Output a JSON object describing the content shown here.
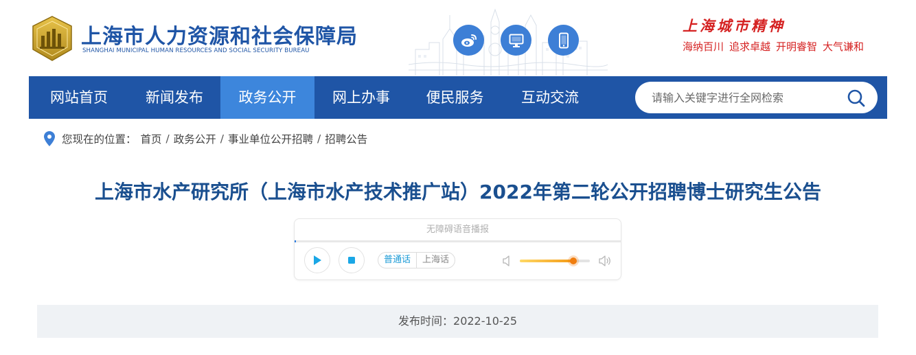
{
  "site": {
    "name_cn": "上海市人力资源和社会保障局",
    "name_en": "SHANGHAI MUNICIPAL HUMAN RESOURCES AND SOCIAL SECURITY BUREAU",
    "logo_icon": "bureau-emblem-icon"
  },
  "header_icons": [
    {
      "name": "weibo-icon"
    },
    {
      "name": "desktop-icon"
    },
    {
      "name": "mobile-icon"
    }
  ],
  "spirit": {
    "title": "上海城市精神",
    "items": [
      "海纳百川",
      "追求卓越",
      "开明睿智",
      "大气谦和"
    ]
  },
  "nav": {
    "items": [
      "网站首页",
      "新闻发布",
      "政务公开",
      "网上办事",
      "便民服务",
      "互动交流"
    ],
    "active": "政务公开"
  },
  "search": {
    "placeholder": "请输入关键字进行全网检索",
    "icon": "search-icon"
  },
  "breadcrumb": {
    "label": "您现在的位置：",
    "items": [
      "首页",
      "政务公开",
      "事业单位公开招聘",
      "招聘公告"
    ],
    "separator": "/"
  },
  "article": {
    "title": "上海市水产研究所（上海市水产技术推广站）2022年第二轮公开招聘博士研究生公告",
    "publish_label": "发布时间：",
    "publish_date": "2022-10-25"
  },
  "player": {
    "header": "无障碍语音播报",
    "languages": [
      "普通话",
      "上海话"
    ],
    "selected_language": "普通话",
    "volume_percent": 76
  },
  "colors": {
    "brand_blue": "#1f55a6",
    "nav_active": "#3d86dc",
    "title_blue": "#1a4f8f",
    "spirit_red": "#d52222",
    "volume_orange": "#f07d0e"
  }
}
